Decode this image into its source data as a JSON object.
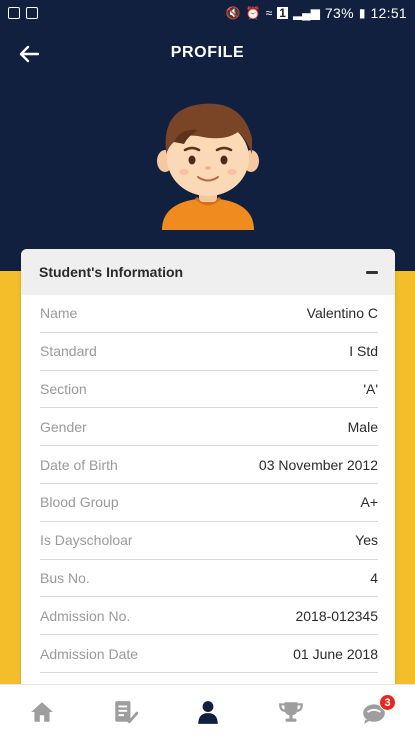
{
  "status_bar": {
    "battery": "73%",
    "time": "12:51",
    "sim_badge": "1"
  },
  "header": {
    "title": "PROFILE"
  },
  "card": {
    "title": "Student's Information",
    "rows": [
      {
        "label": "Name",
        "value": "Valentino C"
      },
      {
        "label": "Standard",
        "value": "I Std"
      },
      {
        "label": "Section",
        "value": "'A'"
      },
      {
        "label": "Gender",
        "value": "Male"
      },
      {
        "label": "Date of Birth",
        "value": "03 November 2012"
      },
      {
        "label": "Blood Group",
        "value": "A+"
      },
      {
        "label": "Is Dayscholoar",
        "value": "Yes"
      },
      {
        "label": "Bus No.",
        "value": "4"
      },
      {
        "label": "Admission No.",
        "value": "2018-012345"
      },
      {
        "label": "Admission Date",
        "value": "01 June 2018"
      }
    ]
  },
  "bottom_nav": {
    "items": [
      {
        "icon": "home-icon",
        "active": false
      },
      {
        "icon": "checklist-icon",
        "active": false
      },
      {
        "icon": "profile-icon",
        "active": true
      },
      {
        "icon": "trophy-icon",
        "active": false
      },
      {
        "icon": "notification-icon",
        "active": false,
        "badge": "3"
      }
    ]
  },
  "colors": {
    "header_bg": "#12203f",
    "accent_yellow": "#f4bd2a",
    "active_nav": "#12203f",
    "inactive_nav": "#9e9e9e",
    "badge": "#e8271f"
  }
}
